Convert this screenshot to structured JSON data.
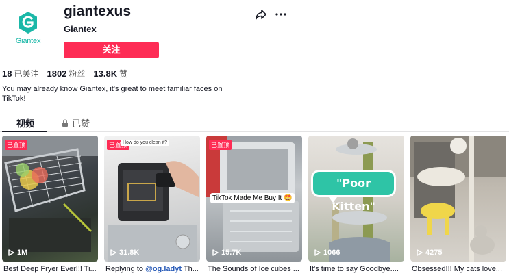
{
  "profile": {
    "username": "giantexus",
    "nickname": "Giantex",
    "logo_text": "Giantex",
    "follow_label": "关注",
    "bio": "You may already know Giantex, it's great to meet familiar faces on TikTok!"
  },
  "stats": {
    "following_count": "18",
    "following_label": "已关注",
    "followers_count": "1802",
    "followers_label": "粉丝",
    "likes_count": "13.8K",
    "likes_label": "赞"
  },
  "tabs": {
    "videos": "视频",
    "liked": "已赞"
  },
  "videos": [
    {
      "pinned": "已置顶",
      "views": "1M",
      "caption": "Best Deep Fryer Ever!!! Ti..."
    },
    {
      "pinned": "已置顶",
      "views": "31.8K",
      "caption_prefix": "Replying to ",
      "mention": "@og.ladyt",
      "caption_suffix": " Th...",
      "note": "How do you clean it?"
    },
    {
      "pinned": "已置顶",
      "views": "15.7K",
      "caption": "The Sounds of Ice cubes ...",
      "overlay": "TikTok Made Me Buy It 🤩"
    },
    {
      "views": "1066",
      "caption": "It's time to say Goodbye....",
      "bubble": "\"Poor Kitten\""
    },
    {
      "views": "4275",
      "caption": "Obsessed!!! My cats love..."
    }
  ],
  "colors": {
    "accent": "#fe2c55",
    "brand_teal": "#1bb8a8",
    "mention": "#2b5db9"
  },
  "icons": [
    "giantex-logo",
    "share-icon",
    "more-icon",
    "lock-icon",
    "play-icon"
  ]
}
